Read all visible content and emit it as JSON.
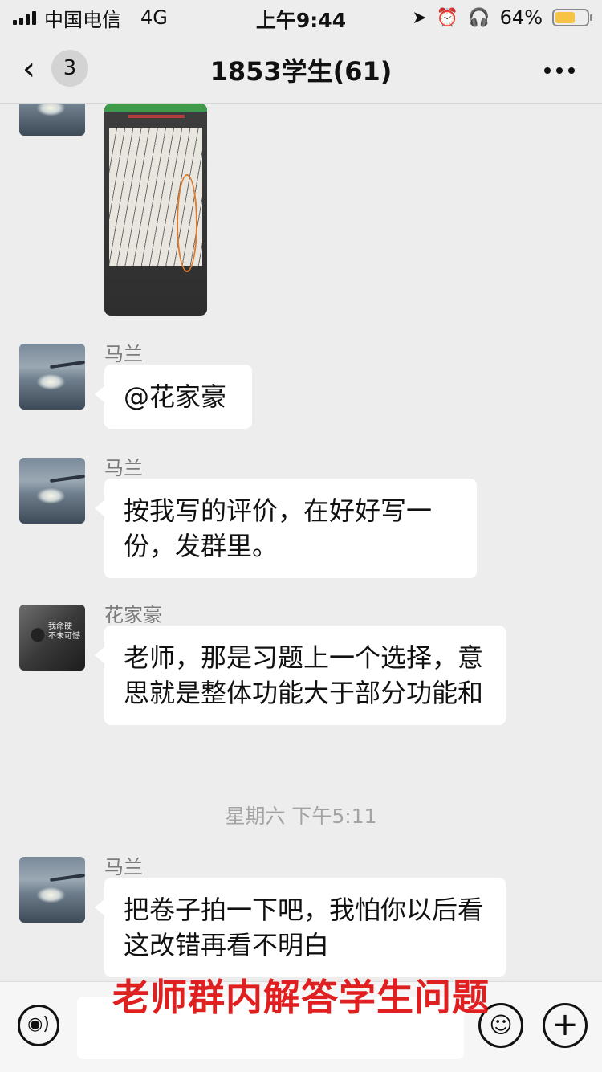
{
  "status_bar": {
    "carrier": "中国电信",
    "network": "4G",
    "time": "上午9:44",
    "battery_percent_label": "64%",
    "battery_level": 0.64,
    "battery_color": "#f6c344"
  },
  "nav": {
    "unread_count": "3",
    "title": "1853学生(61)",
    "back_icon": "chevron-left-icon",
    "more_icon": "more-dots-icon"
  },
  "messages": [
    {
      "type": "image",
      "sender": ""
    },
    {
      "type": "text",
      "sender": "马兰",
      "text": "@花家豪"
    },
    {
      "type": "text",
      "sender": "马兰",
      "text": "按我写的评价，在好好写一份，发群里。"
    },
    {
      "type": "text",
      "sender": "花家豪",
      "text": "老师，那是习题上一个选择，意思就是整体功能大于部分功能和"
    },
    {
      "type": "time",
      "text": "星期六 下午5:11"
    },
    {
      "type": "text",
      "sender": "马兰",
      "text": "把卷子拍一下吧，我怕你以后看这改错再看不明白"
    }
  ],
  "avatar2_text": "我命硬\n不未可憾",
  "overlay_caption": "老师群内解答学生问题",
  "input_bar": {
    "voice_icon": "voice-icon",
    "emoji_icon": "emoji-icon",
    "plus_icon": "plus-icon",
    "placeholder": ""
  },
  "accent_colors": {
    "caption_red": "#e02020",
    "chat_background": "#ededed"
  }
}
